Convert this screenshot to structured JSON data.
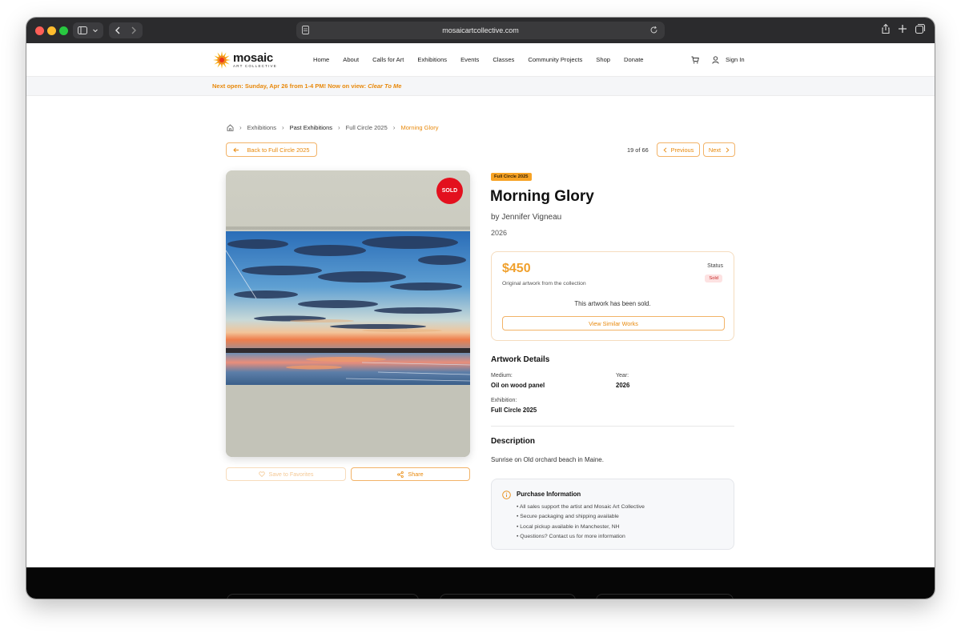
{
  "browser": {
    "url": "mosaicartcollective.com"
  },
  "nav": {
    "logo_main": "mosaic",
    "logo_sub": "ART COLLECTIVE",
    "links": [
      "Home",
      "About",
      "Calls for Art",
      "Exhibitions",
      "Events",
      "Classes",
      "Community Projects",
      "Shop",
      "Donate"
    ],
    "sign_in": "Sign In"
  },
  "banner": {
    "text": "Next open: Sunday, Apr 26 from 1-4 PM! Now on view: ",
    "highlight": "Clear To Me"
  },
  "breadcrumb": {
    "items": [
      "Exhibitions",
      "Past Exhibitions",
      "Full Circle 2025",
      "Morning Glory"
    ]
  },
  "toolbar": {
    "back_label": "Back to Full Circle 2025",
    "counter": "19 of 66",
    "previous_label": "Previous",
    "next_label": "Next"
  },
  "artwork": {
    "sold_badge": "SOLD",
    "exhibition_tag": "Full Circle 2025",
    "title": "Morning Glory",
    "artist": "by Jennifer Vigneau",
    "year": "2026",
    "favorite_label": "Save to Favorites",
    "share_label": "Share"
  },
  "price_card": {
    "price": "$450",
    "subtitle": "Original artwork from the collection",
    "status_label": "Status",
    "status_value": "Sold",
    "sold_message": "This artwork has been sold.",
    "similar_label": "View Similar Works"
  },
  "details": {
    "heading": "Artwork Details",
    "medium_label": "Medium:",
    "medium_value": "Oil on wood panel",
    "year_label": "Year:",
    "year_value": "2026",
    "exhibition_label": "Exhibition:",
    "exhibition_value": "Full Circle 2025"
  },
  "description": {
    "heading": "Description",
    "text": "Sunrise on Old orchard beach in Maine."
  },
  "purchase": {
    "title": "Purchase Information",
    "items": [
      "• All sales support the artist and Mosaic Art Collective",
      "• Secure packaging and shipping available",
      "• Local pickup available in Manchester, NH",
      "• Questions? Contact us for more information"
    ]
  },
  "colors": {
    "accent": "#e8890c",
    "sold_red": "#e3101e",
    "tag_orange": "#f7a325"
  }
}
